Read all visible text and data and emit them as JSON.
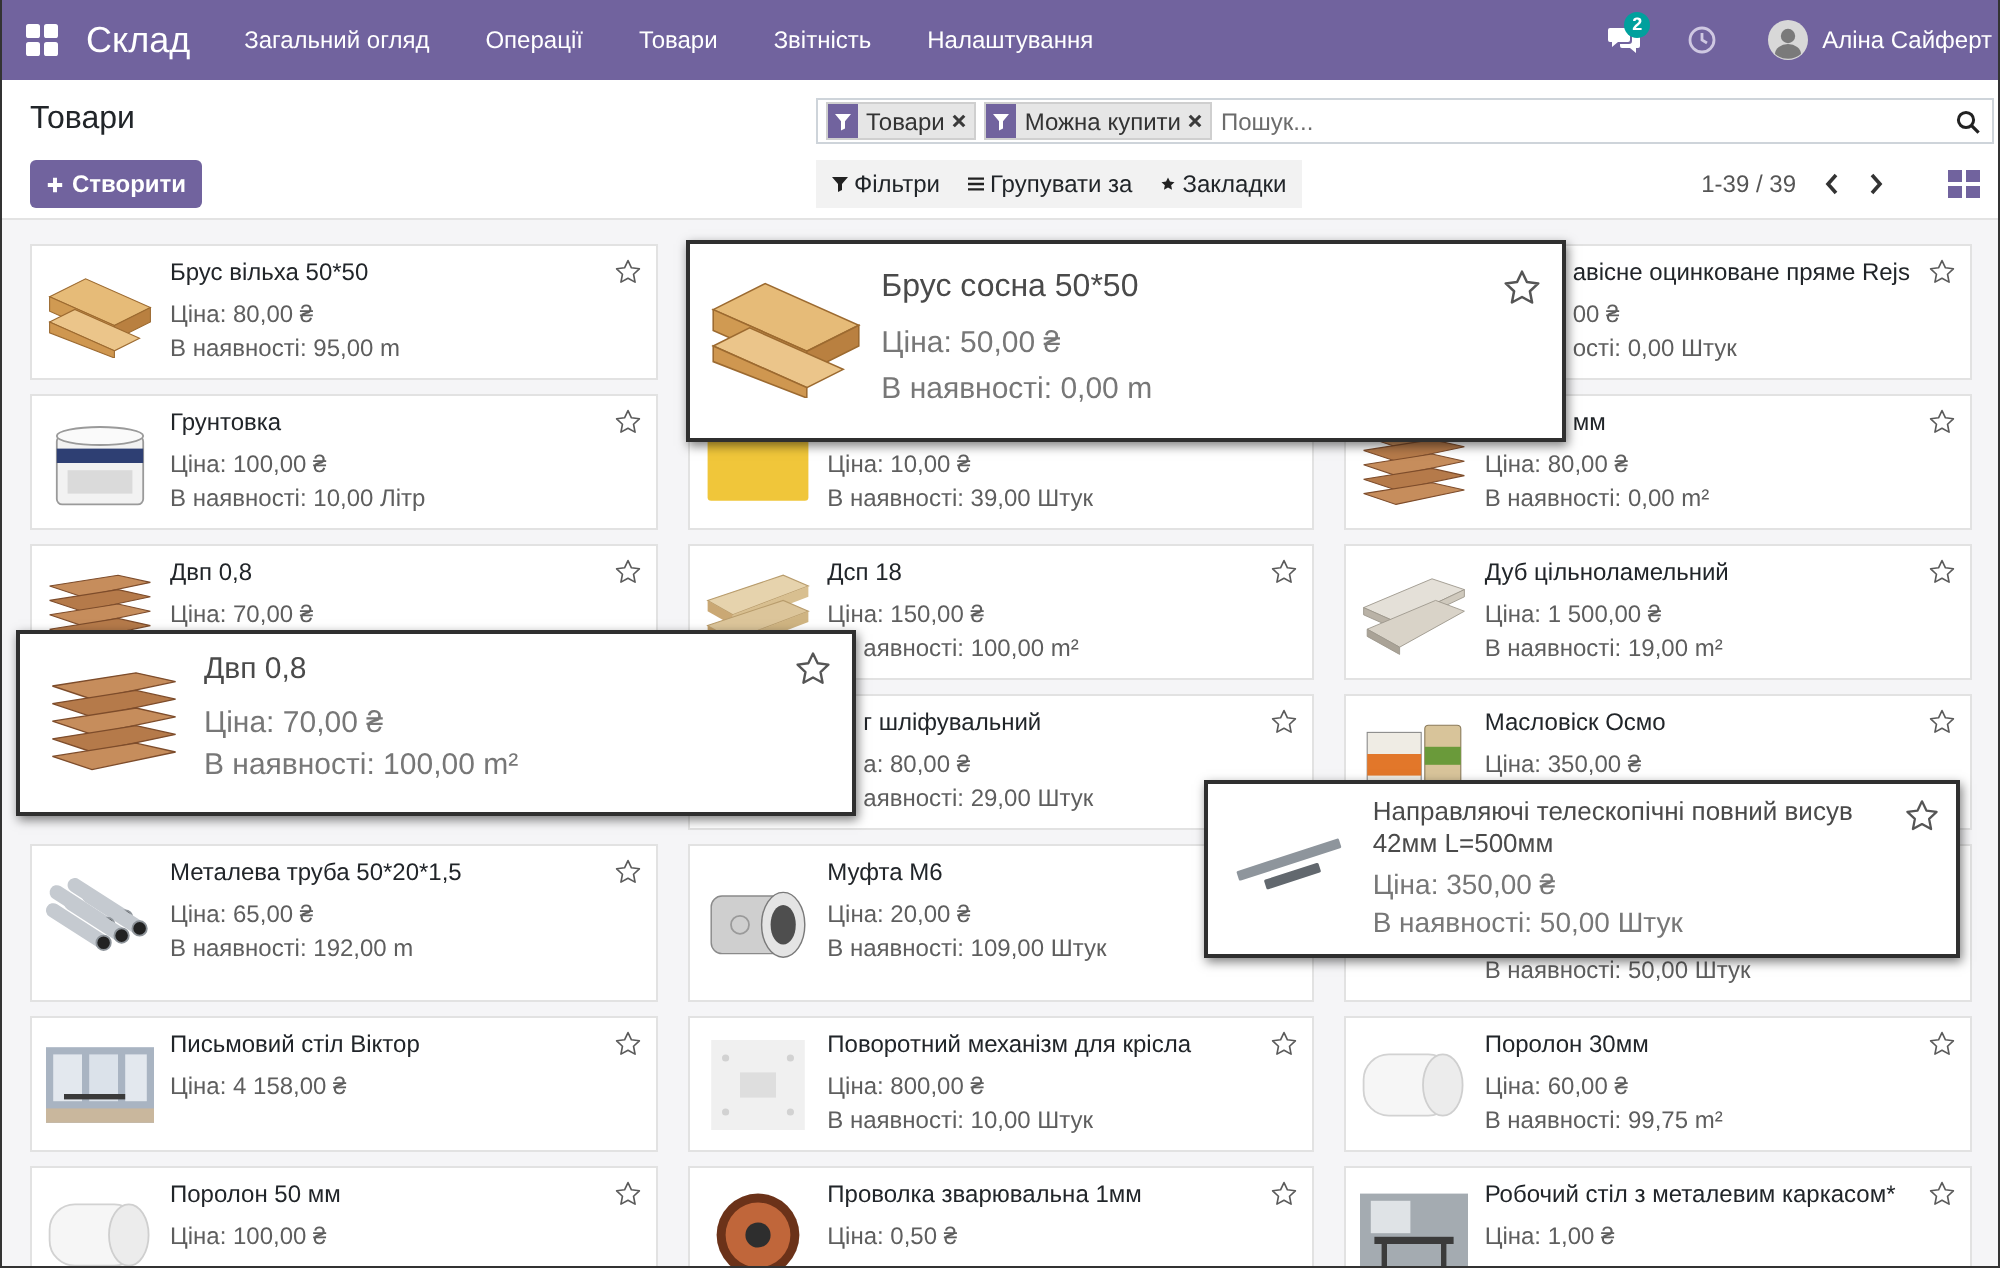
{
  "navbar": {
    "app_name": "Склад",
    "menu": [
      "Загальний огляд",
      "Операції",
      "Товари",
      "Звітність",
      "Налаштування"
    ],
    "messages_badge": "2",
    "user_name": "Аліна Сайферт"
  },
  "control_panel": {
    "title": "Товари",
    "create_button": "Створити",
    "facets": [
      {
        "label": "Товари"
      },
      {
        "label": "Можна купити"
      }
    ],
    "search": {
      "placeholder": "Пошук..."
    },
    "filters_button": "Фільтри",
    "group_by_button": "Групувати за",
    "bookmarks_button": "Закладки",
    "pager": "1-39 / 39"
  },
  "cards": [
    {
      "name": "Брус вільха 50*50",
      "price": "Ціна: 80,00 ₴",
      "stock": "В наявності: 95,00 m",
      "starred": false
    },
    {
      "callout": {
        "name": "Брус сосна 50*50",
        "price": "Ціна: 50,00 ₴",
        "stock": "В наявності: 0,00 m",
        "starred": false
      }
    },
    {
      "name": "авісне оцинковане пряме Rejs",
      "price": "00 ₴",
      "stock": "ості: 0,00 Штук",
      "starred": false
    },
    {
      "name": "Грунтовка",
      "price": "Ціна: 100,00 ₴",
      "stock": "В наявності: 10,00 Літр",
      "starred": false
    },
    {
      "price": "Ціна: 10,00 ₴",
      "stock": "В наявності: 39,00 Штук"
    },
    {
      "name": "мм",
      "price": "Ціна: 80,00 ₴",
      "stock": "В наявності: 0,00 m²",
      "starred": false
    },
    {
      "name": "Двп 0,8",
      "price": "Ціна: 70,00 ₴",
      "starred": false,
      "callout": {
        "name": "Двп 0,8",
        "price": "Ціна: 70,00 ₴",
        "stock": "В наявності: 100,00 m²",
        "starred": false
      }
    },
    {
      "name": "Дсп 18",
      "price": "Ціна: 150,00 ₴",
      "stock": "аявності: 100,00 m²",
      "starred": false
    },
    {
      "name": "Дуб цільноламельний",
      "price": "Ціна: 1 500,00 ₴",
      "stock": "В наявності: 19,00 m²",
      "starred": false
    },
    {
      "name": "г шліфувальний",
      "price": "а: 80,00 ₴",
      "stock": "аявності: 29,00 Штук",
      "starred": false
    },
    {
      "name": "Масловіск Осмо",
      "price": "Ціна: 350,00 ₴",
      "starred": false
    },
    {
      "name": "Металева труба 50*20*1,5",
      "price": "Ціна: 65,00 ₴",
      "stock": "В наявності: 192,00 m",
      "starred": false
    },
    {
      "name": "Муфта М6",
      "price": "Ціна: 20,00 ₴",
      "stock": "В наявності: 109,00 Штук"
    },
    {
      "stock": "В наявності: 50,00 Штук",
      "callout": {
        "name": "Направляючі телескопічні повний висув 42мм L=500мм",
        "price": "Ціна: 350,00 ₴",
        "stock": "В наявності: 50,00 Штук",
        "starred": false
      }
    },
    {
      "name": "Письмовий стіл Віктор",
      "price": "Ціна: 4 158,00 ₴",
      "starred": false
    },
    {
      "name": "Поворотний механізм для крісла",
      "price": "Ціна: 800,00 ₴",
      "stock": "В наявності: 10,00 Штук",
      "starred": false
    },
    {
      "name": "Поролон 30мм",
      "price": "Ціна: 60,00 ₴",
      "stock": "В наявності: 99,75 m²",
      "starred": false
    },
    {
      "name": "Поролон 50 мм",
      "price": "Ціна: 100,00 ₴",
      "starred": false
    },
    {
      "name": "Проволка зварювальна 1мм",
      "price": "Ціна: 0,50 ₴",
      "starred": false
    },
    {
      "name": "Робочий стіл з металевим каркасом*",
      "price": "Ціна: 1,00 ₴",
      "starred": false
    }
  ]
}
